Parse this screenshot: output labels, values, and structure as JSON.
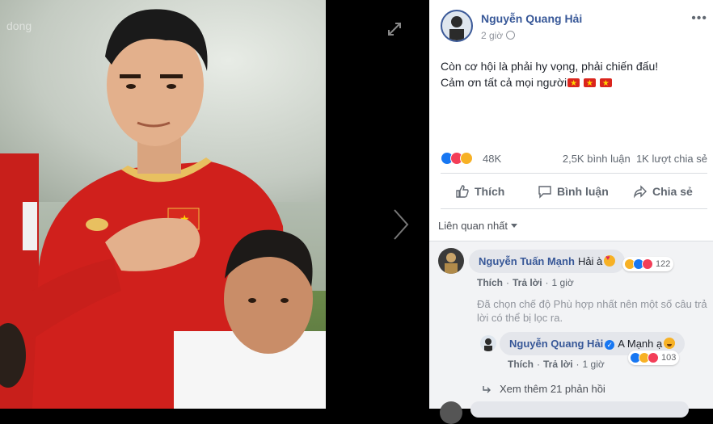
{
  "photo": {
    "watermark": "dong"
  },
  "post": {
    "author": "Nguyễn Quang Hải",
    "time": "2 giờ",
    "text_line1": "Còn cơ hội là phải hy vọng, phải chiến đấu!",
    "text_line2": "Cảm ơn tất cả mọi người",
    "reaction_count": "48K",
    "comments_count": "2,5K bình luận",
    "shares_count": "1K lượt chia sẻ"
  },
  "actions": {
    "like": "Thích",
    "comment": "Bình luận",
    "share": "Chia sẻ"
  },
  "sort": {
    "label": "Liên quan nhất"
  },
  "comments": [
    {
      "author": "Nguyễn Tuấn Mạnh",
      "text": "Hải à",
      "reactions": "122",
      "like_label": "Thích",
      "reply_label": "Trả lời",
      "time": "1 giờ"
    }
  ],
  "filter_note": "Đã chọn chế độ Phù hợp nhất nên một số câu trả lời có thể bị lọc ra.",
  "reply": {
    "author": "Nguyễn Quang Hải",
    "text": "A Mạnh ạ",
    "reactions": "103",
    "like_label": "Thích",
    "reply_label": "Trả lời",
    "time": "1 giờ"
  },
  "see_more": "Xem thêm 21 phản hồi",
  "colors": {
    "link_blue": "#385898",
    "like_blue": "#1877f2",
    "love_red": "#f33e58",
    "haha_yellow": "#f7b125",
    "jersey_red": "#d0201c"
  }
}
